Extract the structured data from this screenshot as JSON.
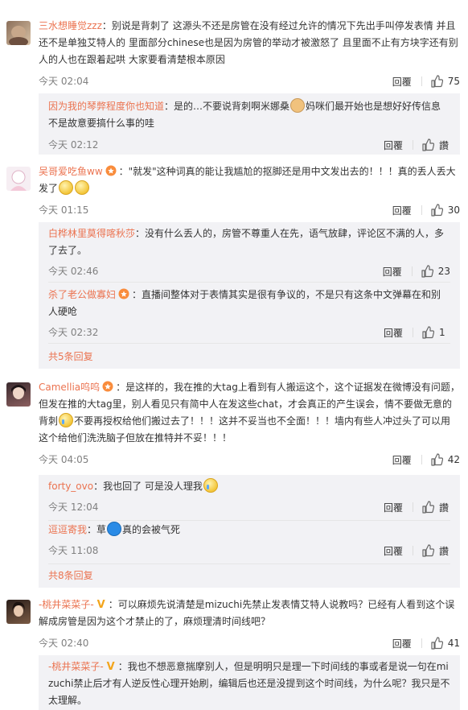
{
  "colors": {
    "accent": "#eb7350",
    "meta": "#808080",
    "reply_bg": "#f2f2f5"
  },
  "icons": {
    "like": "thumbs-up-icon",
    "badge": "fan-badge-icon"
  },
  "c1": {
    "user": "三水想睡觉zzz",
    "text": "：别说是背刺了 这源头不还是房管在没有经过允许的情况下先出手叫停发表情 并且还不是单独艾特人的 里面部分chinese也是因为房管的举动才被激怒了 且里面不止有方块字还有别人的人也在跟着起哄 大家要看清楚根本原因",
    "time": "今天 02:04",
    "reply": "回覆",
    "likes": "75",
    "r1": {
      "user": "因为我的琴弊程度你也知道",
      "text1": "：是的…不要说背刺啊米娜桑",
      "text2": "妈咪们最开始也是想好好传信息不是故意要搞什么事的哇",
      "time": "今天 02:12",
      "reply": "回覆",
      "likes": "讚"
    }
  },
  "c2": {
    "user": "吴哥爱吃鱼ww",
    "text": "：\"就发\"这种词真的能让我尴尬的抠脚还是用中文发出去的！！！真的丢人丢大发了",
    "time": "今天 01:15",
    "reply": "回覆",
    "likes": "30",
    "r1": {
      "user": "白桦林里莫得喀秋莎",
      "text": "：没有什么丢人的，房管不尊重人在先，语气放肆，评论区不满的人，多了去了。",
      "time": "今天 02:46",
      "reply": "回覆",
      "likes": "23"
    },
    "r2": {
      "user": "杀了老公做寡妇",
      "text": "：直播间整体对于表情其实是很有争议的，不是只有这条中文弹幕在和别人硬呛",
      "time": "今天 02:32",
      "reply": "回覆",
      "likes": "1"
    },
    "more": "共5条回复"
  },
  "c3": {
    "user": "Camellia呜呜",
    "text1": "：是这样的，我在推的大tag上看到有人搬运这个，这个证据发在微博没有问题，但发在推的大tag里，别人看见只有简中人在发这些chat，才会真正的产生误会，情不要做无意的背刺",
    "text2": "不要再授权给他们搬过去了！！！这并不妥当也不全面！！！墙内有些人冲过头了可以用这个给他们洗洗脑子但放在推特并不妥！！！",
    "time": "今天 04:05",
    "reply": "回覆",
    "likes": "42",
    "r1": {
      "user": "forty_ovo",
      "text": "：我也回了 可是没人理我",
      "time": "今天 12:04",
      "reply": "回覆",
      "likes": "讚"
    },
    "r2": {
      "user": "逗逗寄我",
      "text1": "：草",
      "text2": "真的会被气死",
      "time": "今天 11:08",
      "reply": "回覆",
      "likes": "讚"
    },
    "more": "共8条回复"
  },
  "c4": {
    "user": "-桃井菜菜子-",
    "text": "：可以麻烦先说清楚是mizuchi先禁止发表情艾特人说教吗？已经有人看到这个误解成房管是因为这个才禁止的了，麻烦理清时间线吧？",
    "time": "今天 02:40",
    "reply": "回覆",
    "likes": "41",
    "r1": {
      "user": "-桃井菜菜子-",
      "text": "：我也不想恶意揣摩别人，但是明明只是理一下时间线的事或者是说一句在mizuchi禁止后才有人逆反性心理开始刷，编辑后也还是没提到这个时间线，为什么呢？我只是不太理解。"
    }
  }
}
